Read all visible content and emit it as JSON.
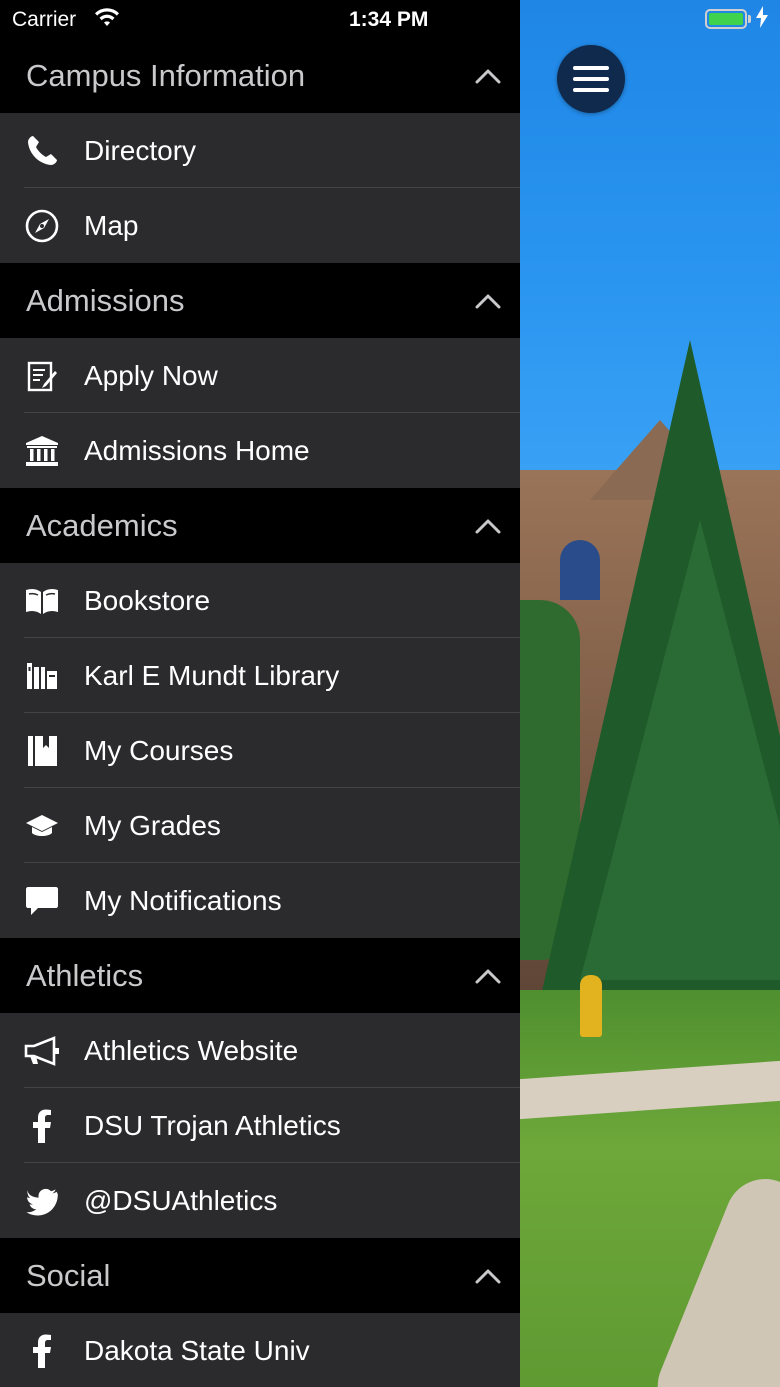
{
  "status_bar": {
    "carrier": "Carrier",
    "time": "1:34 PM"
  },
  "menu": {
    "sections": [
      {
        "title": "Campus Information",
        "items": [
          {
            "label": "Directory",
            "icon": "phone-icon"
          },
          {
            "label": "Map",
            "icon": "compass-icon"
          }
        ]
      },
      {
        "title": "Admissions",
        "items": [
          {
            "label": "Apply Now",
            "icon": "edit-document-icon"
          },
          {
            "label": "Admissions Home",
            "icon": "institution-icon"
          }
        ]
      },
      {
        "title": "Academics",
        "items": [
          {
            "label": "Bookstore",
            "icon": "open-book-icon"
          },
          {
            "label": "Karl E Mundt Library",
            "icon": "library-icon"
          },
          {
            "label": "My Courses",
            "icon": "book-bookmark-icon"
          },
          {
            "label": "My Grades",
            "icon": "graduation-cap-icon"
          },
          {
            "label": "My Notifications",
            "icon": "speech-bubble-icon"
          }
        ]
      },
      {
        "title": "Athletics",
        "items": [
          {
            "label": "Athletics Website",
            "icon": "megaphone-icon"
          },
          {
            "label": "DSU Trojan Athletics",
            "icon": "facebook-icon"
          },
          {
            "label": "@DSUAthletics",
            "icon": "twitter-icon"
          }
        ]
      },
      {
        "title": "Social",
        "items": [
          {
            "label": "Dakota State Univ",
            "icon": "facebook-icon"
          }
        ]
      }
    ]
  },
  "colors": {
    "drawer_bg": "#2b2b2d",
    "section_bg": "#000000",
    "section_text": "#c9c9cc",
    "item_text": "#ffffff",
    "menu_button": "#0f2a4c",
    "battery": "#3fd34d"
  }
}
